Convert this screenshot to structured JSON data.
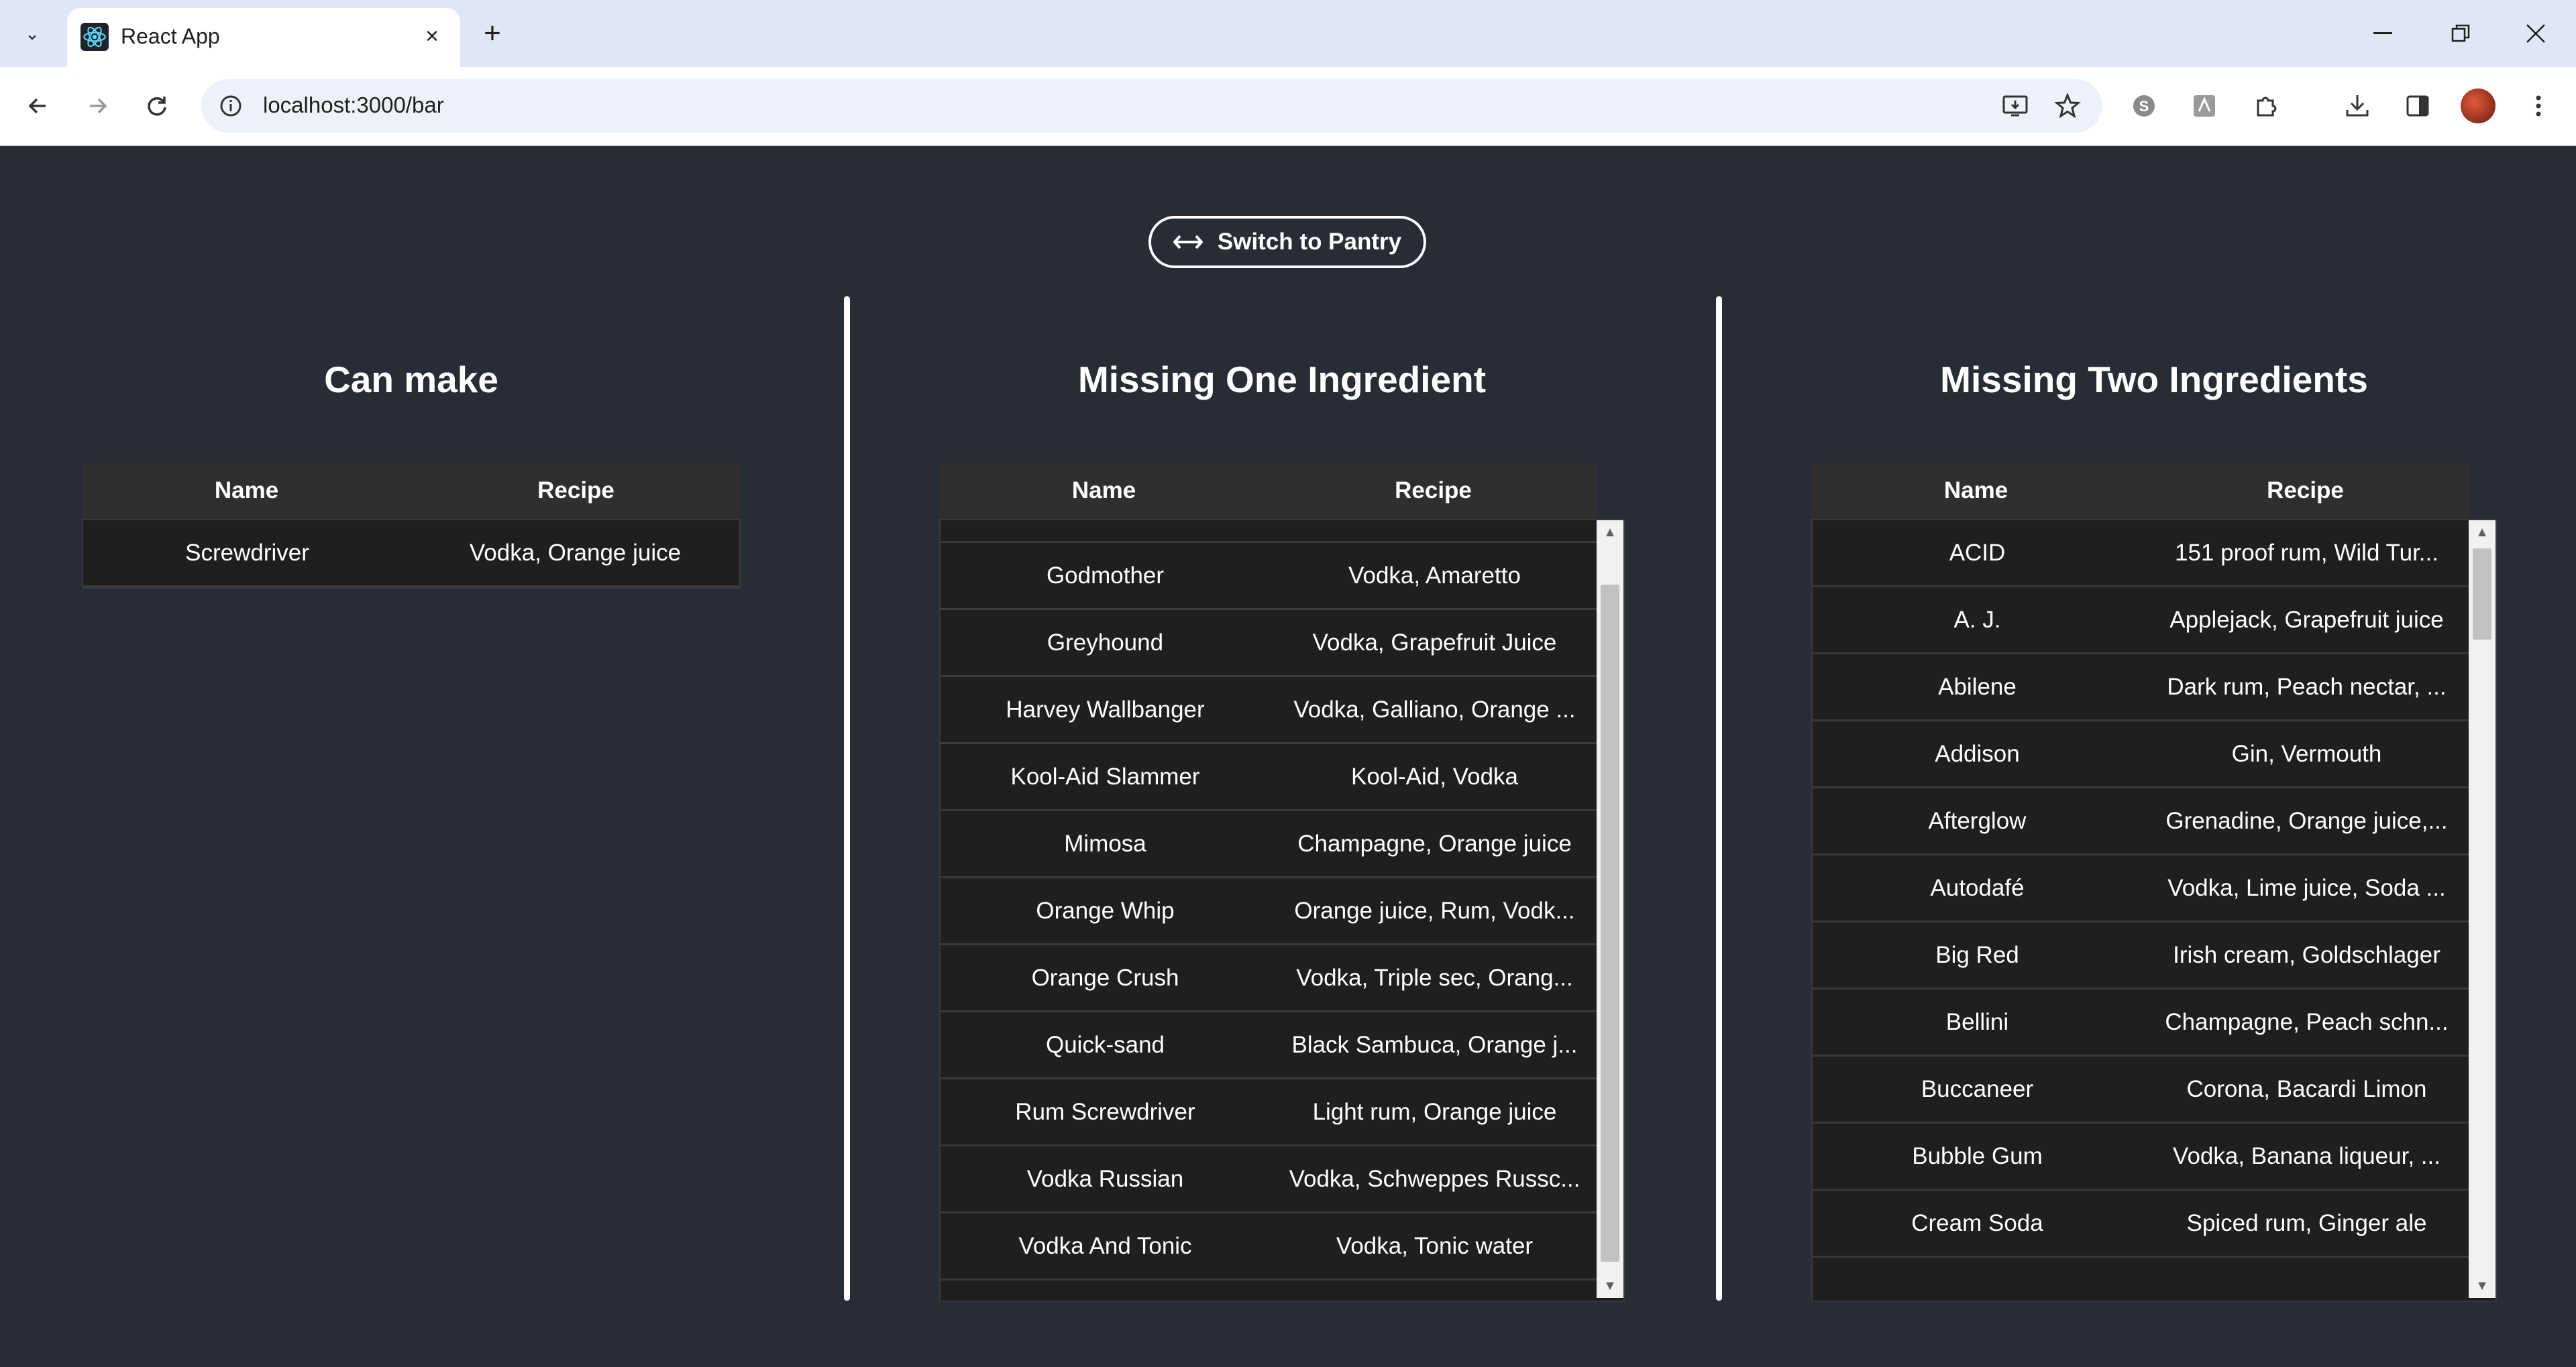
{
  "browser": {
    "tab_title": "React App",
    "url": "localhost:3000/bar"
  },
  "page": {
    "switch_button_label": "Switch to Pantry",
    "columns": [
      {
        "title": "Can make",
        "headers": [
          "Name",
          "Recipe"
        ],
        "rows": [
          [
            "Screwdriver",
            "Vodka, Orange juice"
          ]
        ]
      },
      {
        "title": "Missing One Ingredient",
        "headers": [
          "Name",
          "Recipe"
        ],
        "rows": [
          [
            "Godmother",
            "Vodka, Amaretto"
          ],
          [
            "Greyhound",
            "Vodka, Grapefruit Juice"
          ],
          [
            "Harvey Wallbanger",
            "Vodka, Galliano, Orange ..."
          ],
          [
            "Kool-Aid Slammer",
            "Kool-Aid, Vodka"
          ],
          [
            "Mimosa",
            "Champagne, Orange juice"
          ],
          [
            "Orange Whip",
            "Orange juice, Rum, Vodk..."
          ],
          [
            "Orange Crush",
            "Vodka, Triple sec, Orang..."
          ],
          [
            "Quick-sand",
            "Black Sambuca, Orange j..."
          ],
          [
            "Rum Screwdriver",
            "Light rum, Orange juice"
          ],
          [
            "Vodka Russian",
            "Vodka, Schweppes Russc..."
          ],
          [
            "Vodka And Tonic",
            "Vodka, Tonic water"
          ]
        ]
      },
      {
        "title": "Missing Two Ingredients",
        "headers": [
          "Name",
          "Recipe"
        ],
        "rows": [
          [
            "ACID",
            "151 proof rum, Wild Tur..."
          ],
          [
            "A. J.",
            "Applejack, Grapefruit juice"
          ],
          [
            "Abilene",
            "Dark rum, Peach nectar, ..."
          ],
          [
            "Addison",
            "Gin, Vermouth"
          ],
          [
            "Afterglow",
            "Grenadine, Orange juice,..."
          ],
          [
            "Autodafé",
            "Vodka, Lime juice, Soda ..."
          ],
          [
            "Big Red",
            "Irish cream, Goldschlager"
          ],
          [
            "Bellini",
            "Champagne, Peach schn..."
          ],
          [
            "Buccaneer",
            "Corona, Bacardi Limon"
          ],
          [
            "Bubble Gum",
            "Vodka, Banana liqueur, ..."
          ],
          [
            "Cream Soda",
            "Spiced rum, Ginger ale"
          ]
        ]
      }
    ]
  }
}
